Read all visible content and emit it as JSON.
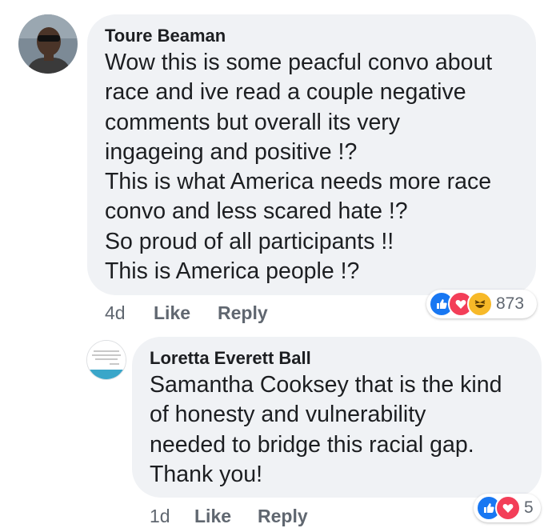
{
  "comment": {
    "author": "Toure Beaman",
    "text": "Wow this is some peacful convo about\nrace and ive read a couple negative\ncomments but overall its very\ningageing and positive !?\nThis is what America needs more race\nconvo and less scared hate !?\nSo proud of all participants !!\nThis is America people !?",
    "time": "4d",
    "like_label": "Like",
    "reply_label": "Reply",
    "reactions": {
      "icons": [
        "like-icon",
        "love-icon",
        "haha-icon"
      ],
      "count": "873",
      "colors": {
        "like": "#1877f2",
        "love": "#f33e58",
        "haha": "#f7b928"
      }
    }
  },
  "reply": {
    "author": "Loretta Everett Ball",
    "text": "Samantha Cooksey that is the kind\nof honesty and vulnerability\nneeded to bridge this racial gap.\nThank you!",
    "time": "1d",
    "like_label": "Like",
    "reply_label": "Reply",
    "reactions": {
      "icons": [
        "like-icon",
        "love-icon"
      ],
      "count": "5"
    }
  }
}
